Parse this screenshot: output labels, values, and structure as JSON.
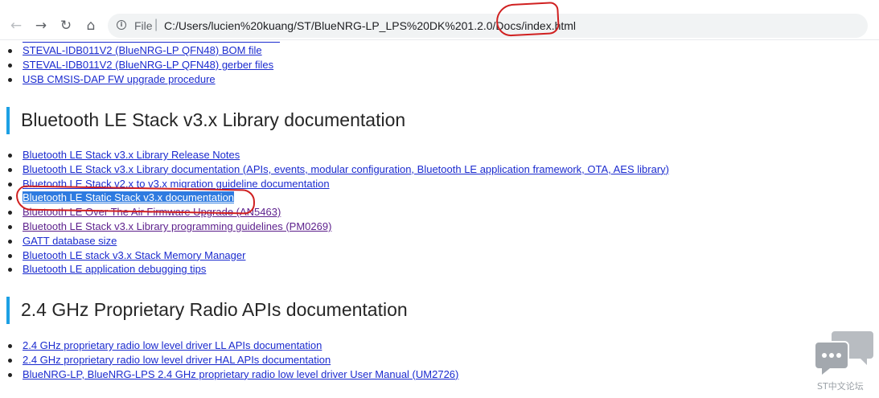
{
  "browser": {
    "scheme_label": "File",
    "url": "C:/Users/lucien%20kuang/ST/BlueNRG-LP_LPS%20DK%201.2.0/Docs/index.html"
  },
  "top_links": [
    "STEVAL-IDB011V2 (BlueNRG-LP QFN48) BOM file",
    "STEVAL-IDB011V2 (BlueNRG-LP QFN48) gerber files",
    "USB CMSIS-DAP FW upgrade procedure"
  ],
  "stack_section": {
    "title": "Bluetooth LE Stack v3.x Library documentation",
    "links": [
      "Bluetooth LE Stack v3.x Library Release Notes",
      "Bluetooth LE Stack v3.x Library documentation (APIs, events, modular configuration, Bluetooth LE application framework, OTA, AES library)",
      "Bluetooth LE Stack v2.x to v3.x migration guideline documentation",
      "Bluetooth LE Static Stack v3.x documentation",
      "Bluetooth LE Over The Air Firmware Upgrade (AN5463)",
      "Bluetooth LE Stack v3.x Library programming guidelines (PM0269)",
      "GATT database size",
      "Bluetooth LE stack v3.x Stack Memory Manager",
      "Bluetooth LE application debugging tips"
    ]
  },
  "radio_section": {
    "title": "2.4 GHz Proprietary Radio APIs documentation",
    "links": [
      "2.4 GHz proprietary radio low level driver LL APIs documentation",
      "2.4 GHz proprietary radio low level driver HAL APIs documentation",
      "BlueNRG-LP, BlueNRG-LPS 2.4 GHz proprietary radio low level driver User Manual (UM2726)"
    ]
  },
  "watermark": {
    "text": "ST中文论坛"
  },
  "colors": {
    "link": "#1b2bcf",
    "visited_link": "#5c1f8c",
    "selection": "#2f7be0",
    "section_bar": "#1ca0e4",
    "annotation": "#d02020"
  },
  "icons": [
    "back-arrow-icon",
    "forward-arrow-icon",
    "reload-icon",
    "home-icon",
    "info-icon",
    "chat-bubbles-icon"
  ]
}
